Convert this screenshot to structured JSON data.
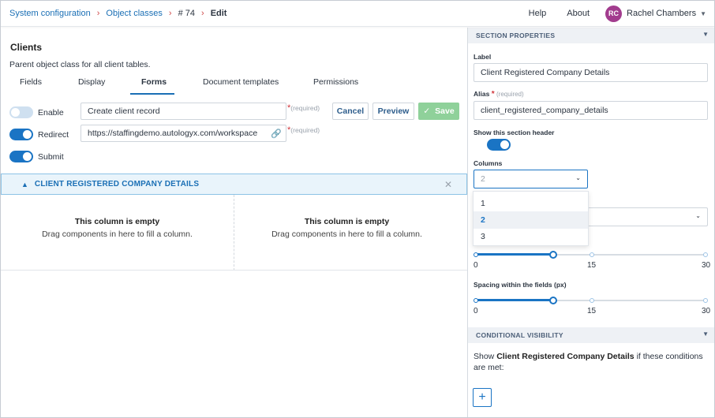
{
  "breadcrumb": {
    "items": [
      "System configuration",
      "Object classes",
      "# 74",
      "Edit"
    ]
  },
  "topbar": {
    "help": "Help",
    "about": "About",
    "avatar_initials": "RC",
    "user_name": "Rachel Chambers"
  },
  "page": {
    "title": "Clients",
    "subtitle": "Parent object class for all client tables."
  },
  "tabs": [
    {
      "label": "Fields",
      "active": false
    },
    {
      "label": "Display",
      "active": false
    },
    {
      "label": "Forms",
      "active": true
    },
    {
      "label": "Document templates",
      "active": false
    },
    {
      "label": "Permissions",
      "active": false
    }
  ],
  "form_settings": {
    "enable": {
      "label": "Enable",
      "on": false,
      "value": "Create client record",
      "required": "(required)"
    },
    "redirect": {
      "label": "Redirect",
      "on": true,
      "value": "https://staffingdemo.autologyx.com/workspace",
      "required": "(required)"
    },
    "submit": {
      "label": "Submit",
      "on": true
    },
    "cancel_label": "Cancel",
    "preview_label": "Preview",
    "save_label": "Save"
  },
  "section": {
    "title": "CLIENT REGISTERED COMPANY DETAILS",
    "columns": [
      {
        "title": "This column is empty",
        "desc": "Drag components in here to fill a column."
      },
      {
        "title": "This column is empty",
        "desc": "Drag components in here to fill a column."
      }
    ]
  },
  "panel": {
    "section_properties": "SECTION PROPERTIES",
    "label_label": "Label",
    "label_value": "Client Registered Company Details",
    "alias_label": "Alias",
    "alias_required": "(required)",
    "alias_value": "client_registered_company_details",
    "show_header_label": "Show this section header",
    "show_header_on": true,
    "columns_label": "Columns",
    "columns_value": "2",
    "columns_options": [
      "1",
      "2",
      "3"
    ],
    "columns_selected": "2",
    "slider1": {
      "value": 7,
      "ticks": [
        "0",
        "15",
        "30"
      ]
    },
    "slider2_label": "Spacing within the fields (px)",
    "slider2": {
      "value": 7,
      "ticks": [
        "0",
        "15",
        "30"
      ]
    },
    "conditional_visibility": "CONDITIONAL VISIBILITY",
    "cond_prefix": "Show ",
    "cond_bold": "Client Registered Company Details",
    "cond_suffix": " if these conditions are met:",
    "add_label": "+"
  },
  "colors": {
    "accent": "#1a74c4",
    "link": "#1a6fb5",
    "save": "#8fd19a",
    "avatar": "#a23c8e"
  }
}
